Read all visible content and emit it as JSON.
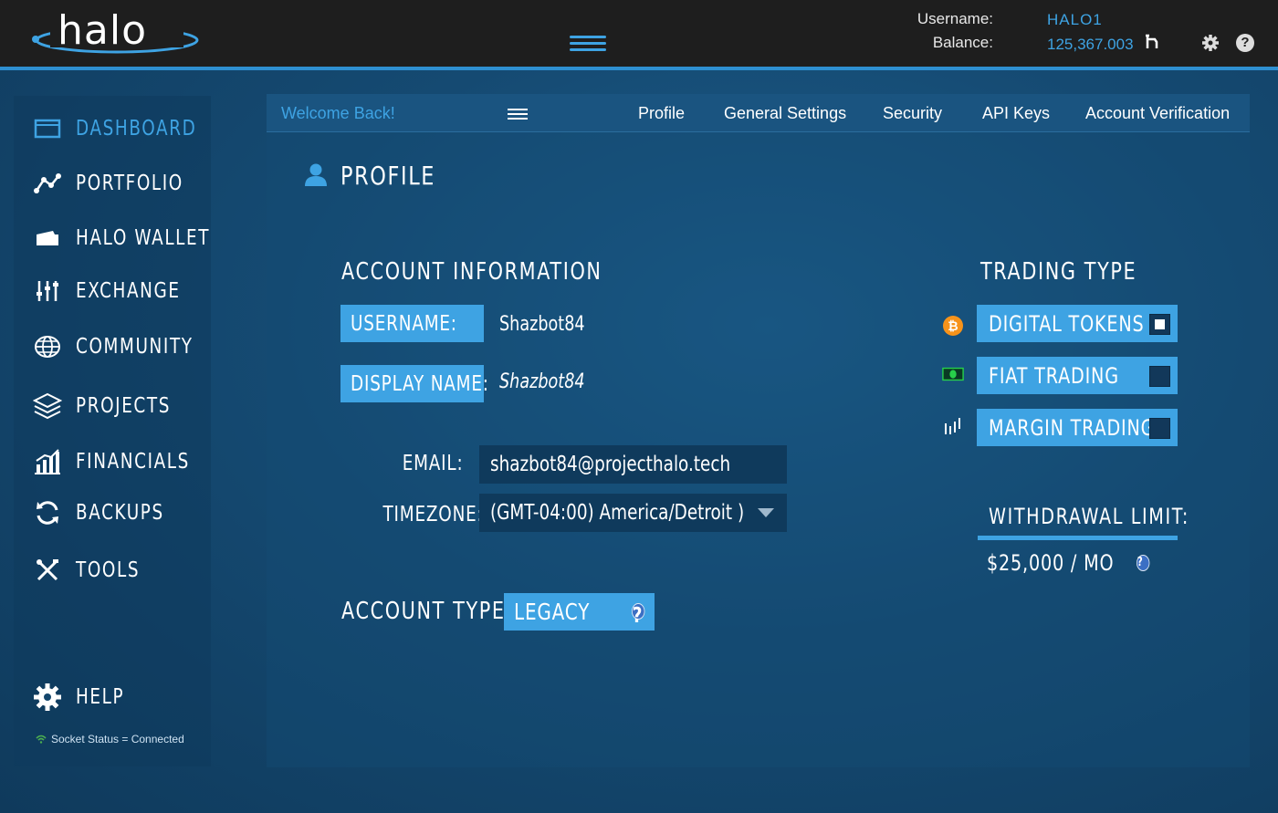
{
  "header": {
    "brand": "halo",
    "username_label": "Username:",
    "username_value": "HALO1",
    "balance_label": "Balance:",
    "balance_value": "125,367.003",
    "accent_color": "#3ea3e3"
  },
  "sidebar": {
    "items": [
      {
        "label": "DASHBOARD",
        "icon": "dashboard-icon",
        "active": true
      },
      {
        "label": "PORTFOLIO",
        "icon": "portfolio-icon"
      },
      {
        "label": "HALO WALLET",
        "icon": "wallet-icon"
      },
      {
        "label": "EXCHANGE",
        "icon": "exchange-icon"
      },
      {
        "label": "COMMUNITY",
        "icon": "globe-icon"
      },
      {
        "label": "PROJECTS",
        "icon": "layers-icon"
      },
      {
        "label": "FINANCIALS",
        "icon": "bar-chart-icon"
      },
      {
        "label": "BACKUPS",
        "icon": "refresh-icon"
      },
      {
        "label": "TOOLS",
        "icon": "tools-icon"
      }
    ],
    "help_label": "HELP",
    "socket_status": "Socket Status = Connected"
  },
  "subnav": {
    "welcome": "Welcome Back!",
    "tabs": [
      "Profile",
      "General Settings",
      "Security",
      "API Keys",
      "Account Verification"
    ]
  },
  "profile": {
    "title": "PROFILE",
    "account_info_title": "ACCOUNT INFORMATION",
    "username_label": "USERNAME:",
    "username_value": "Shazbot84",
    "display_name_label": "DISPLAY NAME:",
    "display_name_value": "Shazbot84",
    "email_label": "EMAIL:",
    "email_value": "shazbot84@projecthalo.tech",
    "timezone_label": "TIMEZONE:",
    "timezone_value": "(GMT-04:00) America/Detroit )",
    "account_type_label": "ACCOUNT TYPE",
    "account_type_value": "LEGACY"
  },
  "trading": {
    "title": "TRADING TYPE",
    "options": [
      {
        "label": "DIGITAL TOKENS",
        "checked": true,
        "icon": "bitcoin-icon"
      },
      {
        "label": "FIAT TRADING",
        "checked": false,
        "icon": "cash-icon"
      },
      {
        "label": "MARGIN TRADING",
        "checked": false,
        "icon": "margin-chart-icon"
      }
    ],
    "withdrawal_label": "WITHDRAWAL LIMIT:",
    "withdrawal_value": "$25,000 / MO"
  }
}
